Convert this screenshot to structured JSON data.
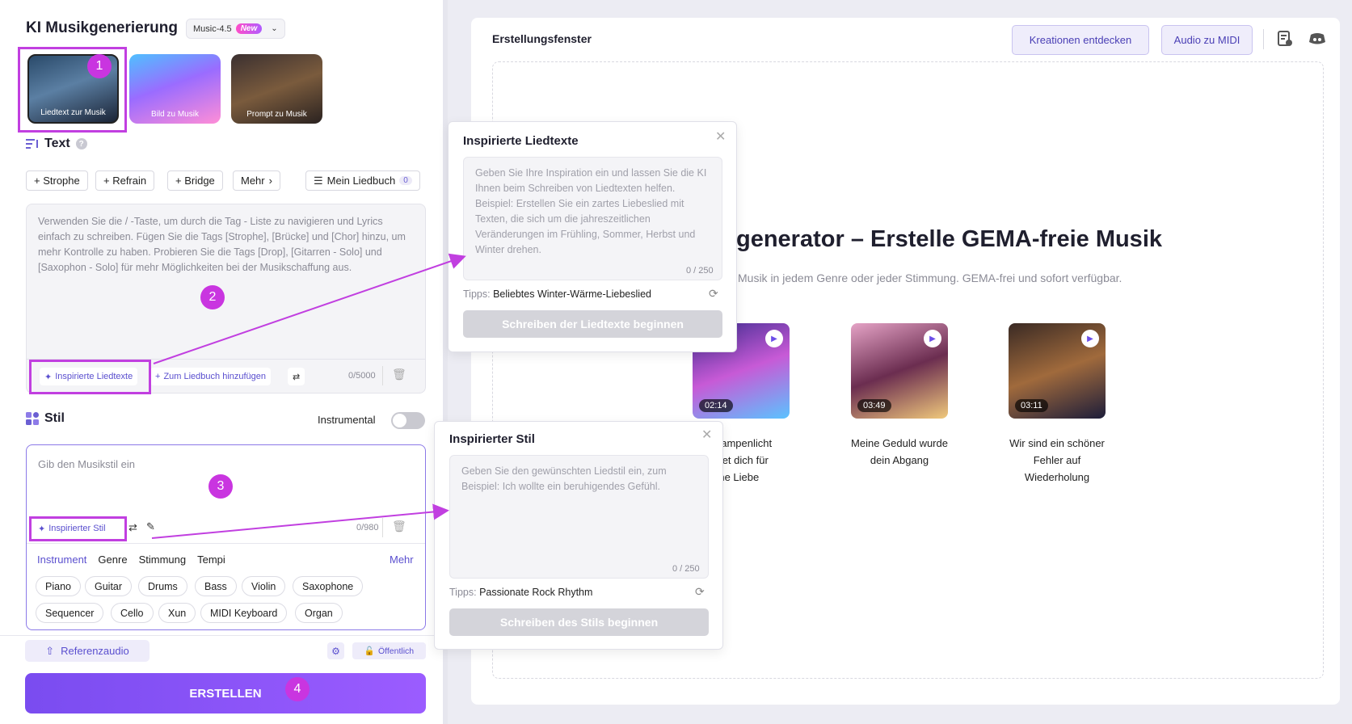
{
  "app": {
    "title": "KI Musikgenerierung",
    "model": "Music-4.5",
    "model_badge": "New"
  },
  "modes": [
    {
      "label": "Liedtext zur Musik",
      "selected": true
    },
    {
      "label": "Bild zu Musik",
      "selected": false
    },
    {
      "label": "Prompt zu Musik",
      "selected": false
    }
  ],
  "callouts": [
    "1",
    "2",
    "3",
    "4"
  ],
  "text_section": {
    "heading": "Text",
    "buttons": [
      "+ Strophe",
      "+ Refrain",
      "+ Bridge",
      "Mehr"
    ],
    "songbook_label": "Mein Liedbuch",
    "songbook_count": "0",
    "placeholder": "Verwenden Sie die / -Taste, um durch die Tag - Liste zu navigieren und Lyrics einfach zu schreiben. Fügen Sie die Tags [Strophe], [Brücke] und [Chor] hinzu, um mehr Kontrolle zu haben. Probieren Sie die Tags [Drop], [Gitarren - Solo] und [Saxophon - Solo] für mehr Möglichkeiten bei der Musikschaffung aus.",
    "inspire_btn": "Inspirierte Liedtexte",
    "add_songbook_btn": "Zum Liedbuch hinzufügen",
    "counter": "0/5000"
  },
  "style_section": {
    "heading": "Stil",
    "instrumental_label": "Instrumental",
    "placeholder": "Gib den Musikstil ein",
    "inspire_btn": "Inspirierter Stil",
    "counter": "0/980",
    "tabs": [
      "Instrument",
      "Genre",
      "Stimmung",
      "Tempi"
    ],
    "more": "Mehr",
    "chips_row1": [
      "Piano",
      "Guitar",
      "Drums",
      "Bass",
      "Violin",
      "Saxophone"
    ],
    "chips_row2": [
      "Sequencer",
      "Cello",
      "Xun",
      "MIDI Keyboard",
      "Organ"
    ]
  },
  "footer": {
    "reference_audio": "Referenzaudio",
    "public": "Öffentlich",
    "create": "ERSTELLEN"
  },
  "right": {
    "card_title": "Erstellungsfenster",
    "btn_discover": "Kreationen entdecken",
    "btn_midi": "Audio zu MIDI",
    "hero_title": "generator – Erstelle GEMA-freie Musik",
    "hero_sub": "Musik in jedem Genre oder jeder Stimmung. GEMA-frei und sofort verfügbar.",
    "songs": [
      {
        "time": "02:14",
        "caption_lines": [
          "n Rampenlicht",
          "endet dich für",
          "neine Liebe"
        ]
      },
      {
        "time": "03:49",
        "caption_lines": [
          "Meine Geduld wurde",
          "dein Abgang"
        ]
      },
      {
        "time": "03:11",
        "caption_lines": [
          "Wir sind ein schöner",
          "Fehler auf",
          "Wiederholung"
        ]
      }
    ]
  },
  "popup_lyrics": {
    "title": "Inspirierte Liedtexte",
    "placeholder": "Geben Sie Ihre Inspiration ein und lassen Sie die KI Ihnen beim Schreiben von Liedtexten helfen. Beispiel: Erstellen Sie ein zartes Liebeslied mit Texten, die sich um die jahreszeitlichen Veränderungen im Frühling, Sommer, Herbst und Winter drehen.",
    "counter": "0 / 250",
    "tips_label": "Tipps:",
    "tips_value": "Beliebtes Winter-Wärme-Liebeslied",
    "button": "Schreiben der Liedtexte beginnen"
  },
  "popup_style": {
    "title": "Inspirierter Stil",
    "placeholder": "Geben Sie den gewünschten Liedstil ein, zum Beispiel: Ich wollte ein beruhigendes Gefühl.",
    "counter": "0 / 250",
    "tips_label": "Tipps:",
    "tips_value": "Passionate Rock Rhythm",
    "button": "Schreiben des Stils beginnen"
  },
  "colors": {
    "accent": "#7a4cf0",
    "callout": "#c935e0",
    "highlight_border": "#c13fe0"
  }
}
